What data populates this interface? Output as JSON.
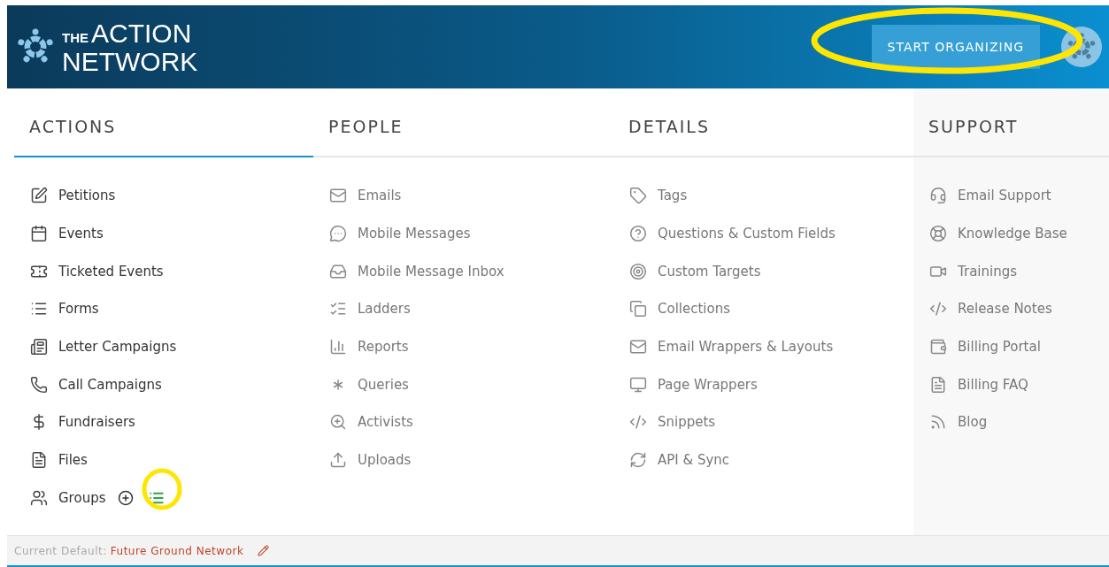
{
  "header": {
    "logo": {
      "prefix": "THE",
      "line1": "ACTION",
      "line2": "NETWORK"
    },
    "button": "START ORGANIZING"
  },
  "columns": [
    {
      "heading": "ACTIONS",
      "selected": true,
      "items": [
        {
          "label": "Petitions",
          "kind": "link"
        },
        {
          "label": "Events",
          "kind": "link"
        },
        {
          "label": "Ticketed Events",
          "kind": "link"
        },
        {
          "label": "Forms",
          "kind": "link"
        },
        {
          "label": "Letter Campaigns",
          "kind": "link"
        },
        {
          "label": "Call Campaigns",
          "kind": "link"
        },
        {
          "label": "Fundraisers",
          "kind": "link"
        },
        {
          "label": "Files",
          "kind": "link"
        },
        {
          "label": "Groups",
          "kind": "with-actions"
        }
      ]
    },
    {
      "heading": "PEOPLE",
      "selected": false,
      "items": [
        {
          "label": "Emails",
          "kind": "link"
        },
        {
          "label": "Mobile Messages",
          "kind": "link"
        },
        {
          "label": "Mobile Message Inbox",
          "kind": "link"
        },
        {
          "label": "Ladders",
          "kind": "link"
        },
        {
          "label": "Reports",
          "kind": "link"
        },
        {
          "label": "Queries",
          "kind": "link"
        },
        {
          "label": "Activists",
          "kind": "link"
        },
        {
          "label": "Uploads",
          "kind": "link"
        }
      ]
    },
    {
      "heading": "DETAILS",
      "selected": false,
      "items": [
        {
          "label": "Tags",
          "kind": "link"
        },
        {
          "label": "Questions & Custom Fields",
          "kind": "link"
        },
        {
          "label": "Custom Targets",
          "kind": "link"
        },
        {
          "label": "Collections",
          "kind": "link"
        },
        {
          "label": "Email Wrappers & Layouts",
          "kind": "link"
        },
        {
          "label": "Page Wrappers",
          "kind": "link"
        },
        {
          "label": "Snippets",
          "kind": "link"
        },
        {
          "label": "API & Sync",
          "kind": "link"
        }
      ]
    },
    {
      "heading": "SUPPORT",
      "selected": false,
      "items": [
        {
          "label": "Email Support",
          "kind": "link"
        },
        {
          "label": "Knowledge Base",
          "kind": "link"
        },
        {
          "label": "Trainings",
          "kind": "link"
        },
        {
          "label": "Release Notes",
          "kind": "link"
        },
        {
          "label": "Billing Portal",
          "kind": "link"
        },
        {
          "label": "Billing FAQ",
          "kind": "link"
        },
        {
          "label": "Blog",
          "kind": "link"
        }
      ]
    }
  ],
  "footer": {
    "label": "Current Default:",
    "value": "Future Ground Network"
  }
}
